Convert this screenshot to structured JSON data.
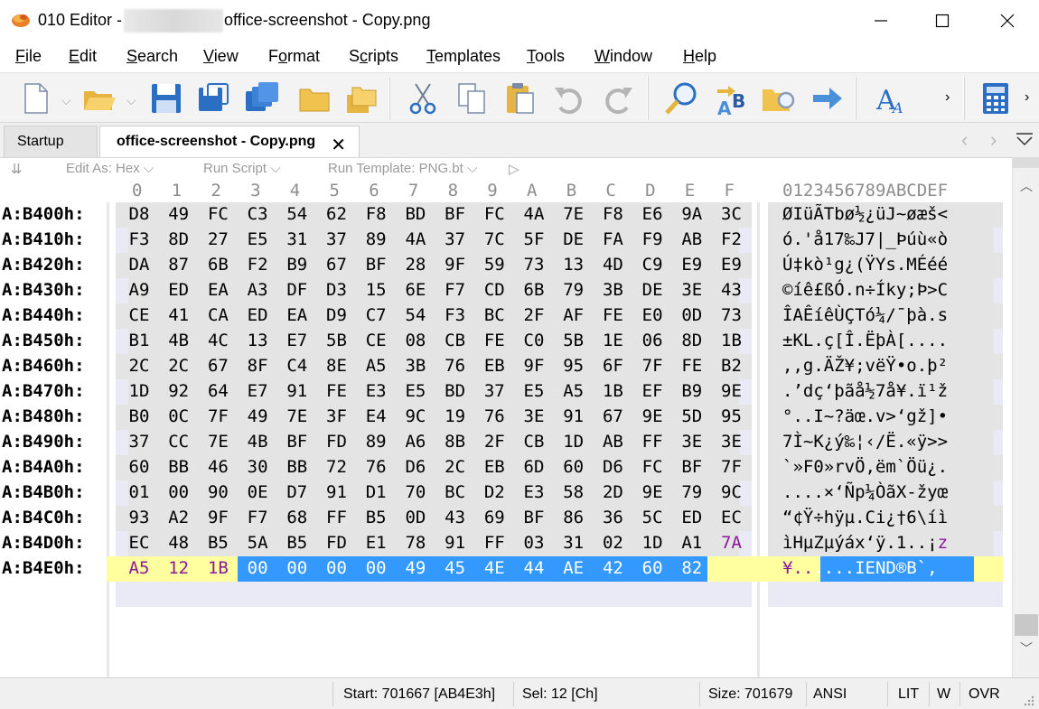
{
  "window": {
    "app_name": "010 Editor -",
    "file_name": "office-screenshot - Copy.png"
  },
  "menu": [
    {
      "label": "File",
      "key": "F"
    },
    {
      "label": "Edit",
      "key": "E"
    },
    {
      "label": "Search",
      "key": "S"
    },
    {
      "label": "View",
      "key": "V"
    },
    {
      "label": "Format",
      "key": "o"
    },
    {
      "label": "Scripts",
      "key": "c"
    },
    {
      "label": "Templates",
      "key": "T"
    },
    {
      "label": "Tools",
      "key": "T"
    },
    {
      "label": "Window",
      "key": "W"
    },
    {
      "label": "Help",
      "key": "H"
    }
  ],
  "toolbar": {
    "icons": [
      "new-file-icon",
      "open-folder-icon",
      "save-icon",
      "save-as-icon",
      "save-all-icon",
      "folder-icon",
      "folders-icon",
      "cut-icon",
      "copy-icon",
      "paste-icon",
      "undo-icon",
      "redo-icon",
      "find-icon",
      "replace-icon",
      "find-in-files-icon",
      "goto-icon",
      "font-icon",
      "calculator-icon"
    ]
  },
  "tabs": [
    {
      "label": "Startup",
      "active": false
    },
    {
      "label": "office-screenshot - Copy.png",
      "active": true
    }
  ],
  "editbar": {
    "edit_as": "Edit As: Hex",
    "run_script": "Run Script",
    "run_template": "Run Template: PNG.bt"
  },
  "hex_view": {
    "col_headers": [
      "0",
      "1",
      "2",
      "3",
      "4",
      "5",
      "6",
      "7",
      "8",
      "9",
      "A",
      "B",
      "C",
      "D",
      "E",
      "F"
    ],
    "ascii_header": "0123456789ABCDEF",
    "rows": [
      {
        "addr": "A:B400h:",
        "bytes": [
          "D8",
          "49",
          "FC",
          "C3",
          "54",
          "62",
          "F8",
          "BD",
          "BF",
          "FC",
          "4A",
          "7E",
          "F8",
          "E6",
          "9A",
          "3C"
        ],
        "ascii": "ØIüÃTbø½¿üJ~øæš<"
      },
      {
        "addr": "A:B410h:",
        "bytes": [
          "F3",
          "8D",
          "27",
          "E5",
          "31",
          "37",
          "89",
          "4A",
          "37",
          "7C",
          "5F",
          "DE",
          "FA",
          "F9",
          "AB",
          "F2"
        ],
        "ascii": "ó.'å17‰J7|_Þúù«ò"
      },
      {
        "addr": "A:B420h:",
        "bytes": [
          "DA",
          "87",
          "6B",
          "F2",
          "B9",
          "67",
          "BF",
          "28",
          "9F",
          "59",
          "73",
          "13",
          "4D",
          "C9",
          "E9",
          "E9"
        ],
        "ascii": "Ú‡kò¹g¿(ŸYs.MÉéé"
      },
      {
        "addr": "A:B430h:",
        "bytes": [
          "A9",
          "ED",
          "EA",
          "A3",
          "DF",
          "D3",
          "15",
          "6E",
          "F7",
          "CD",
          "6B",
          "79",
          "3B",
          "DE",
          "3E",
          "43"
        ],
        "ascii": "©íê£ßÓ.n÷Íky;Þ>C"
      },
      {
        "addr": "A:B440h:",
        "bytes": [
          "CE",
          "41",
          "CA",
          "ED",
          "EA",
          "D9",
          "C7",
          "54",
          "F3",
          "BC",
          "2F",
          "AF",
          "FE",
          "E0",
          "0D",
          "73"
        ],
        "ascii": "ÎAÊíêÙÇTó¼/¯þà.s"
      },
      {
        "addr": "A:B450h:",
        "bytes": [
          "B1",
          "4B",
          "4C",
          "13",
          "E7",
          "5B",
          "CE",
          "08",
          "CB",
          "FE",
          "C0",
          "5B",
          "1E",
          "06",
          "8D",
          "1B"
        ],
        "ascii": "±KL.ç[Î.ËþÀ[...."
      },
      {
        "addr": "A:B460h:",
        "bytes": [
          "2C",
          "2C",
          "67",
          "8F",
          "C4",
          "8E",
          "A5",
          "3B",
          "76",
          "EB",
          "9F",
          "95",
          "6F",
          "7F",
          "FE",
          "B2"
        ],
        "ascii": ",,g.ÄŽ¥;vëŸ•o.þ²"
      },
      {
        "addr": "A:B470h:",
        "bytes": [
          "1D",
          "92",
          "64",
          "E7",
          "91",
          "FE",
          "E3",
          "E5",
          "BD",
          "37",
          "E5",
          "A5",
          "1B",
          "EF",
          "B9",
          "9E"
        ],
        "ascii": ".’dç‘þãå½7å¥.ï¹ž"
      },
      {
        "addr": "A:B480h:",
        "bytes": [
          "B0",
          "0C",
          "7F",
          "49",
          "7E",
          "3F",
          "E4",
          "9C",
          "19",
          "76",
          "3E",
          "91",
          "67",
          "9E",
          "5D",
          "95"
        ],
        "ascii": "°..I~?äœ.v>‘gž]•"
      },
      {
        "addr": "A:B490h:",
        "bytes": [
          "37",
          "CC",
          "7E",
          "4B",
          "BF",
          "FD",
          "89",
          "A6",
          "8B",
          "2F",
          "CB",
          "1D",
          "AB",
          "FF",
          "3E",
          "3E"
        ],
        "ascii": "7Ì~K¿ý‰¦‹/Ë.«ÿ>>"
      },
      {
        "addr": "A:B4A0h:",
        "bytes": [
          "60",
          "BB",
          "46",
          "30",
          "BB",
          "72",
          "76",
          "D6",
          "2C",
          "EB",
          "6D",
          "60",
          "D6",
          "FC",
          "BF",
          "7F"
        ],
        "ascii": "`»F0»rvÖ,ëm`Öü¿."
      },
      {
        "addr": "A:B4B0h:",
        "bytes": [
          "01",
          "00",
          "90",
          "0E",
          "D7",
          "91",
          "D1",
          "70",
          "BC",
          "D2",
          "E3",
          "58",
          "2D",
          "9E",
          "79",
          "9C"
        ],
        "ascii": "....×‘Ñp¼ÒãX-žyœ"
      },
      {
        "addr": "A:B4C0h:",
        "bytes": [
          "93",
          "A2",
          "9F",
          "F7",
          "68",
          "FF",
          "B5",
          "0D",
          "43",
          "69",
          "BF",
          "86",
          "36",
          "5C",
          "ED",
          "EC"
        ],
        "ascii": "“¢Ÿ÷hÿµ.Ci¿†6\\íì"
      },
      {
        "addr": "A:B4D0h:",
        "bytes": [
          "EC",
          "48",
          "B5",
          "5A",
          "B5",
          "FD",
          "E1",
          "78",
          "91",
          "FF",
          "03",
          "31",
          "02",
          "1D",
          "A1",
          "7A"
        ],
        "ascii_plain": "ìHµZµýáx‘ÿ.1..¡",
        "ascii_purple": "z"
      },
      {
        "addr": "A:B4E0h:",
        "bytes": [
          "A5",
          "12",
          "1B",
          "00",
          "00",
          "00",
          "00",
          "49",
          "45",
          "4E",
          "44",
          "AE",
          "42",
          "60",
          "82"
        ],
        "ascii_purple": "¥..",
        "ascii_selected": "....IEND®B`‚"
      }
    ]
  },
  "status": {
    "start": "Start: 701667 [AB4E3h]",
    "sel": "Sel: 12 [Ch]",
    "size": "Size: 701679",
    "encoding": "ANSI",
    "endian": "LIT",
    "mode_w": "W",
    "mode_ovr": "OVR"
  },
  "colors": {
    "band_grey": "#e4e4e4",
    "band_light": "#eaeaf7",
    "selection_blue": "#3399ff",
    "current_row_yellow": "#ffffa0",
    "purple_text": "#8a1a9b"
  }
}
